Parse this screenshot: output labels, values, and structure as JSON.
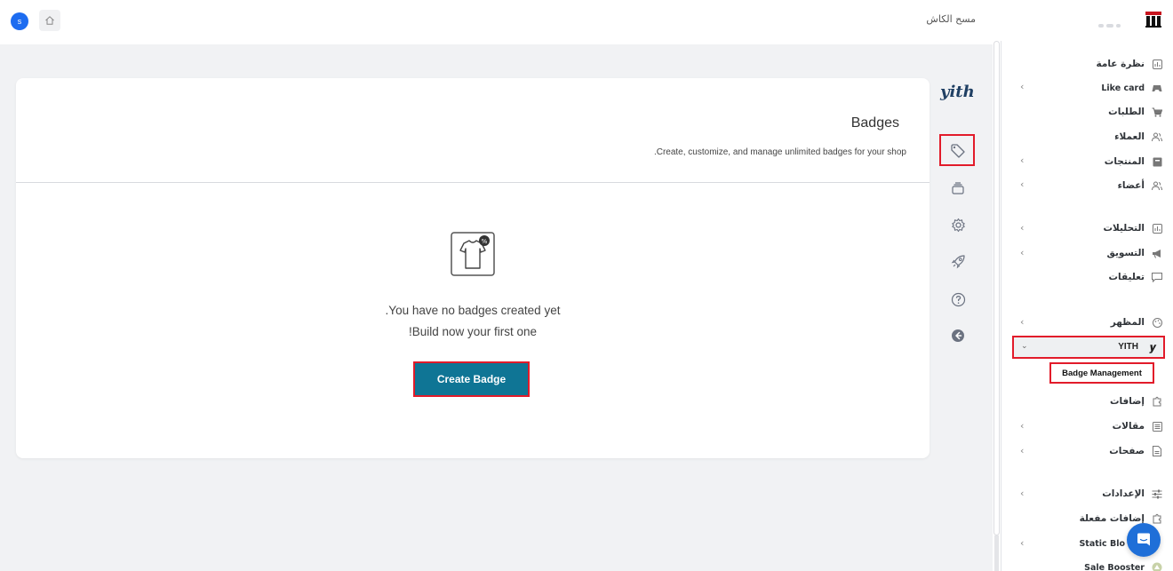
{
  "topbar": {
    "avatar_letter": "s",
    "cache_link": "مسح الكاش"
  },
  "card": {
    "title": "Badges",
    "description": ".Create, customize, and manage unlimited badges for your shop",
    "empty_line1": ".You have no badges created yet",
    "empty_line2": "!Build now your first one",
    "create_button": "Create Badge"
  },
  "yith_logo": "yith",
  "sidebar": {
    "items": [
      {
        "label": "نظرة عامة",
        "icon": "dashboard-icon"
      },
      {
        "label": "Like card",
        "icon": "gamepad-icon",
        "has_chevron": true
      },
      {
        "label": "الطلبات",
        "icon": "cart-icon"
      },
      {
        "label": "العملاء",
        "icon": "users-icon"
      },
      {
        "label": "المنتجات",
        "icon": "archive-icon",
        "has_chevron": true
      },
      {
        "label": "أعضاء",
        "icon": "users-icon",
        "has_chevron": true
      },
      {
        "label": "التحليلات",
        "icon": "chart-icon",
        "has_chevron": true
      },
      {
        "label": "التسويق",
        "icon": "megaphone-icon",
        "has_chevron": true
      },
      {
        "label": "تعليقات",
        "icon": "comment-icon"
      },
      {
        "label": "المظهر",
        "icon": "palette-icon",
        "has_chevron": true
      },
      {
        "label": "YITH",
        "icon": "yith-icon",
        "expanded": true
      },
      {
        "label": "إضافات",
        "icon": "plugin-icon"
      },
      {
        "label": "مقالات",
        "icon": "post-icon",
        "has_chevron": true
      },
      {
        "label": "صفحات",
        "icon": "page-icon",
        "has_chevron": true
      },
      {
        "label": "الإعدادات",
        "icon": "settings-icon",
        "has_chevron": true
      },
      {
        "label": "إضافات مفعلة",
        "icon": "plugin-icon"
      },
      {
        "label": "Static Blo",
        "icon": "block-icon",
        "has_chevron": true
      },
      {
        "label": "Sale Booster",
        "icon": "booster-icon"
      }
    ],
    "yith_submenu": "Badge Management"
  },
  "colors": {
    "accent": "#0f7595",
    "highlight": "#e21b2a",
    "chat": "#1f6fd8"
  }
}
